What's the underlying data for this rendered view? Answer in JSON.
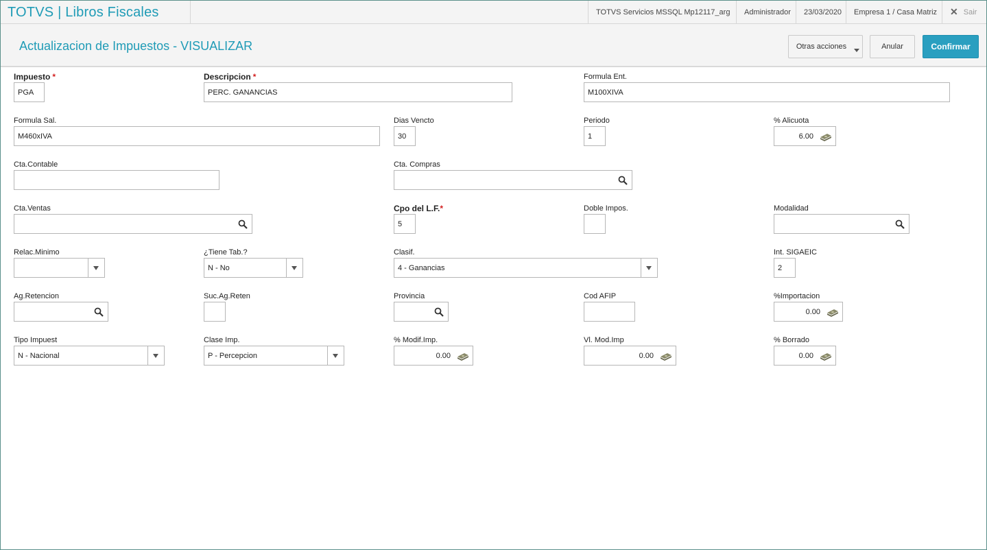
{
  "app": {
    "title": "TOTVS | Libros Fiscales"
  },
  "topbar": {
    "server": "TOTVS Servicios MSSQL Mp12117_arg",
    "user": "Administrador",
    "date": "23/03/2020",
    "company": "Empresa 1 / Casa Matriz",
    "exit_label": "Sair"
  },
  "header": {
    "title": "Actualizacion de Impuestos - VISUALIZAR",
    "other_actions": "Otras acciones",
    "cancel": "Anular",
    "confirm": "Confirmar"
  },
  "form": {
    "impuesto": {
      "label": "Impuesto",
      "value": "PGA"
    },
    "descripcion": {
      "label": "Descripcion",
      "value": "PERC. GANANCIAS"
    },
    "formula_ent": {
      "label": "Formula Ent.",
      "value": "M100XIVA"
    },
    "formula_sal": {
      "label": "Formula Sal.",
      "value": "M460xIVA"
    },
    "dias_vencto": {
      "label": "Dias Vencto",
      "value": "30"
    },
    "periodo": {
      "label": "Periodo",
      "value": "1"
    },
    "alicuota": {
      "label": "% Alicuota",
      "value": "6.00"
    },
    "cta_contable": {
      "label": "Cta.Contable",
      "value": ""
    },
    "cta_compras": {
      "label": "Cta. Compras",
      "value": ""
    },
    "cta_ventas": {
      "label": "Cta.Ventas",
      "value": ""
    },
    "cpo_lf": {
      "label": "Cpo del L.F.",
      "value": "5"
    },
    "doble_impos": {
      "label": "Doble Impos.",
      "value": ""
    },
    "modalidad": {
      "label": "Modalidad",
      "value": ""
    },
    "relac_minimo": {
      "label": "Relac.Minimo",
      "value": ""
    },
    "tiene_tab": {
      "label": "¿Tiene Tab.?",
      "value": "N -  No"
    },
    "clasif": {
      "label": "Clasif.",
      "value": "4 - Ganancias"
    },
    "int_sigaeic": {
      "label": "Int. SIGAEIC",
      "value": "2"
    },
    "ag_retencion": {
      "label": "Ag.Retencion",
      "value": ""
    },
    "suc_ag_reten": {
      "label": "Suc.Ag.Reten",
      "value": ""
    },
    "provincia": {
      "label": "Provincia",
      "value": ""
    },
    "cod_afip": {
      "label": "Cod AFIP",
      "value": ""
    },
    "importacion": {
      "label": "%Importacion",
      "value": "0.00"
    },
    "tipo_impuest": {
      "label": "Tipo Impuest",
      "value": "N - Nacional"
    },
    "clase_imp": {
      "label": "Clase Imp.",
      "value": "P - Percepcion"
    },
    "modif_imp": {
      "label": "% Modif.Imp.",
      "value": "0.00"
    },
    "vl_mod_imp": {
      "label": "Vl. Mod.Imp",
      "value": "0.00"
    },
    "borrado": {
      "label": "% Borrado",
      "value": "0.00"
    }
  },
  "icons": {
    "search": "magnifier-icon",
    "calculator": "money-icon",
    "dropdown": "chevron-down-icon",
    "close": "close-icon"
  },
  "colors": {
    "accent": "#1f9bb6",
    "primary_button": "#2a9fc0",
    "required": "#d21e1e"
  }
}
